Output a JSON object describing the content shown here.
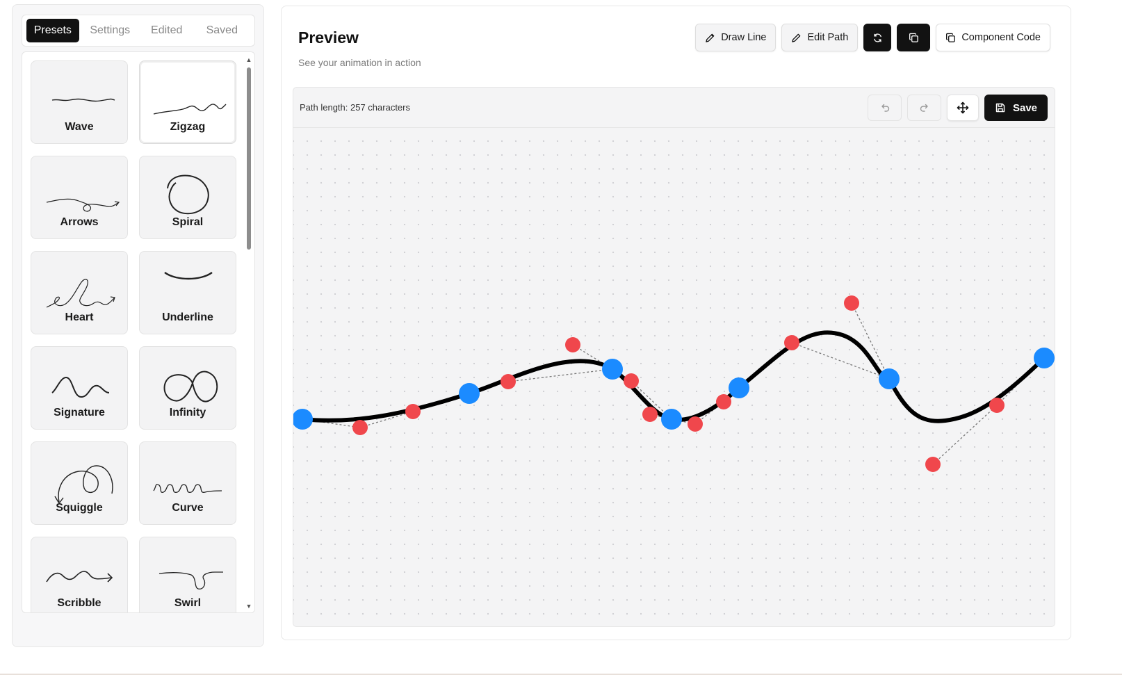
{
  "sidebar": {
    "tabs": [
      {
        "label": "Presets",
        "active": true
      },
      {
        "label": "Settings",
        "active": false
      },
      {
        "label": "Edited",
        "active": false
      },
      {
        "label": "Saved",
        "active": false
      }
    ],
    "presets": [
      {
        "label": "Wave",
        "icon": "wave-preset-icon",
        "selected": false
      },
      {
        "label": "Zigzag",
        "icon": "zigzag-preset-icon",
        "selected": true
      },
      {
        "label": "Arrows",
        "icon": "arrows-preset-icon",
        "selected": false
      },
      {
        "label": "Spiral",
        "icon": "spiral-preset-icon",
        "selected": false
      },
      {
        "label": "Heart",
        "icon": "heart-preset-icon",
        "selected": false
      },
      {
        "label": "Underline",
        "icon": "underline-preset-icon",
        "selected": false
      },
      {
        "label": "Signature",
        "icon": "signature-preset-icon",
        "selected": false
      },
      {
        "label": "Infinity",
        "icon": "infinity-preset-icon",
        "selected": false
      },
      {
        "label": "Squiggle",
        "icon": "squiggle-preset-icon",
        "selected": false
      },
      {
        "label": "Curve",
        "icon": "curve-preset-icon",
        "selected": false
      },
      {
        "label": "Scribble",
        "icon": "scribble-preset-icon",
        "selected": false
      },
      {
        "label": "Swirl",
        "icon": "swirl-preset-icon",
        "selected": false
      }
    ]
  },
  "main": {
    "title": "Preview",
    "subtitle": "See your animation in action",
    "toolbar": {
      "draw_line": "Draw Line",
      "edit_path": "Edit Path",
      "component_code": "Component Code"
    },
    "canvas": {
      "path_length": "Path length: 257 characters",
      "save": "Save"
    }
  },
  "colors": {
    "anchor_point": "#1b8bff",
    "control_point": "#f0474c",
    "path_stroke": "#000000",
    "button_dark": "#121212"
  }
}
